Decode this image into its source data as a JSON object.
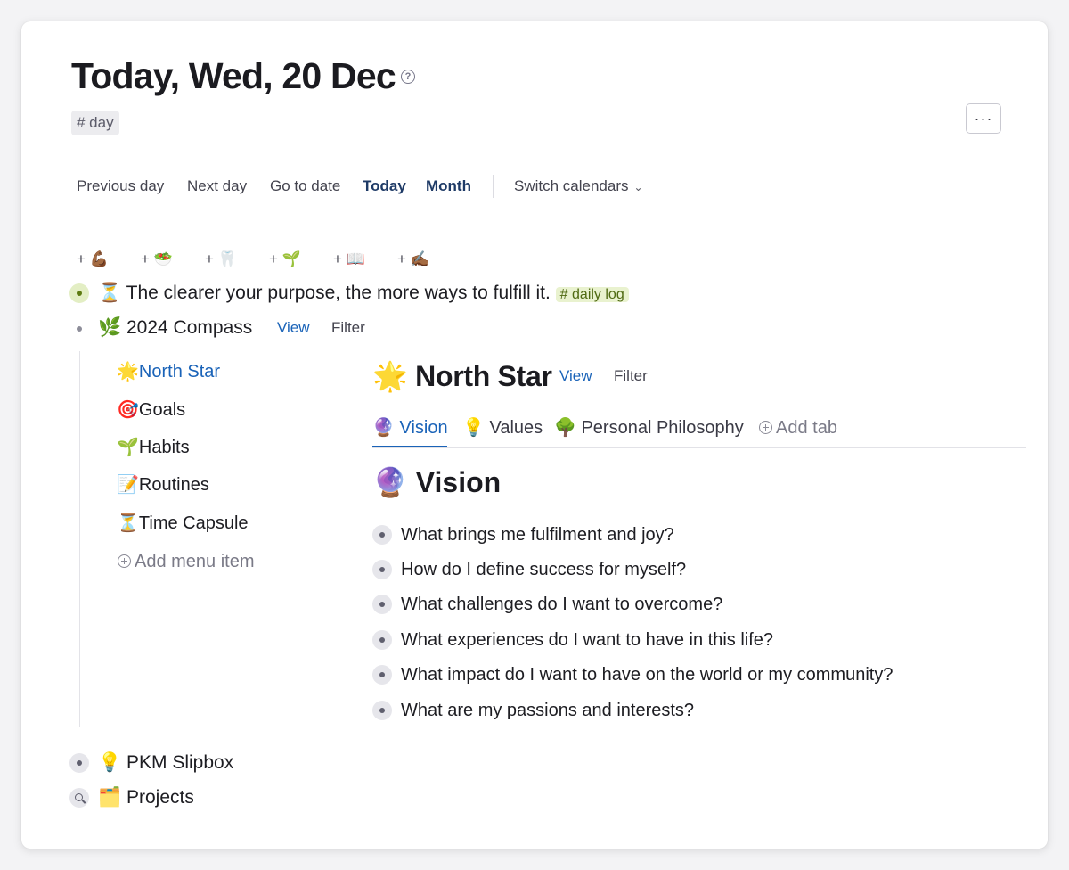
{
  "header": {
    "title": "Today, Wed, 20 Dec",
    "help_icon": "question-circle-icon",
    "tag": "# day",
    "more_label": "···"
  },
  "nav": {
    "previous": "Previous day",
    "next": "Next day",
    "go_to_date": "Go to date",
    "today": "Today",
    "month": "Month",
    "switch_calendars": "Switch calendars",
    "switch_chevron": "⌄"
  },
  "quick_add": [
    {
      "plus": "+",
      "emoji": "💪🏾"
    },
    {
      "plus": "+",
      "emoji": "🥗"
    },
    {
      "plus": "+",
      "emoji": "🦷"
    },
    {
      "plus": "+",
      "emoji": "🌱"
    },
    {
      "plus": "+",
      "emoji": "📖"
    },
    {
      "plus": "+",
      "emoji": "✍🏾"
    }
  ],
  "outline": {
    "purpose": {
      "emoji": "⏳",
      "text": "The clearer your purpose, the more ways to fulfill it.",
      "tag": "# daily log"
    },
    "compass": {
      "emoji": "🌿",
      "text": "2024 Compass",
      "view": "View",
      "filter": "Filter"
    },
    "pkm": {
      "emoji": "💡",
      "text": "PKM Slipbox"
    },
    "projects": {
      "emoji": "🗂️",
      "text": "Projects"
    }
  },
  "menu": {
    "items": [
      {
        "emoji": "🌟",
        "label": "North Star"
      },
      {
        "emoji": "🎯",
        "label": "Goals"
      },
      {
        "emoji": "🌱",
        "label": "Habits"
      },
      {
        "emoji": "📝",
        "label": "Routines"
      },
      {
        "emoji": "⏳",
        "label": "Time Capsule"
      }
    ],
    "add_label": "Add menu item"
  },
  "north_star": {
    "emoji": "🌟",
    "title": "North Star",
    "view": "View",
    "filter": "Filter",
    "tabs": [
      {
        "emoji": "🔮",
        "label": "Vision"
      },
      {
        "emoji": "💡",
        "label": "Values"
      },
      {
        "emoji": "🌳",
        "label": "Personal Philosophy"
      }
    ],
    "add_tab": "Add tab",
    "section": {
      "emoji": "🔮",
      "title": "Vision"
    },
    "questions": [
      "What brings me fulfilment and joy?",
      "How do I define success for myself?",
      "What challenges do I want to overcome?",
      "What experiences do I want to have in this life?",
      "What impact do I want to have on the world or my community?",
      "What are my passions and interests?"
    ]
  },
  "colors": {
    "accent": "#1a63b8",
    "nav_bold": "#1e3a66",
    "tag_green_bg": "#e9f2cf",
    "tag_green_text": "#4f6a12"
  }
}
